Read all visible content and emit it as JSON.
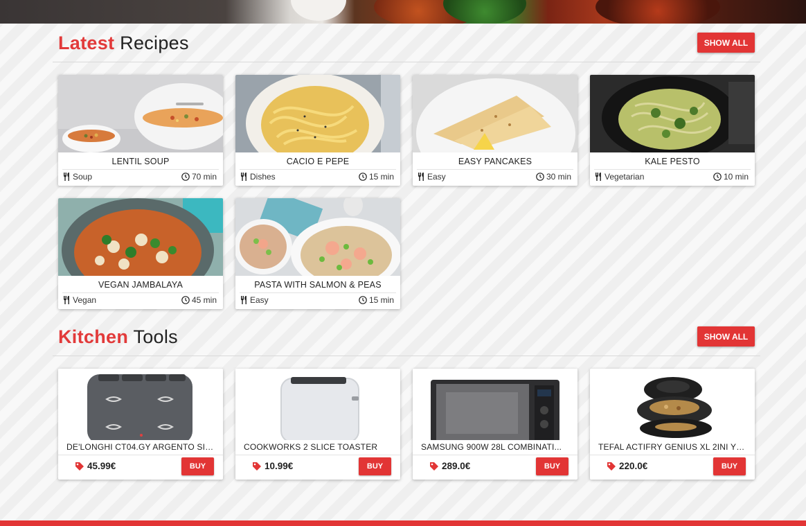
{
  "latest": {
    "title_accent": "Latest",
    "title_rest": "Recipes",
    "show_all": "SHOW ALL",
    "recipes": [
      {
        "name": "LENTIL SOUP",
        "category": "Soup",
        "time": "70 min"
      },
      {
        "name": "CACIO E PEPE",
        "category": "Dishes",
        "time": "15 min"
      },
      {
        "name": "EASY PANCAKES",
        "category": "Easy",
        "time": "30 min"
      },
      {
        "name": "KALE PESTO",
        "category": "Vegetarian",
        "time": "10 min"
      },
      {
        "name": "VEGAN JAMBALAYA",
        "category": "Vegan",
        "time": "45 min"
      },
      {
        "name": "PASTA WITH SALMON & PEAS",
        "category": "Easy",
        "time": "15 min"
      }
    ]
  },
  "tools": {
    "title_accent": "Kitchen",
    "title_rest": "Tools",
    "show_all": "SHOW ALL",
    "buy_label": "BUY",
    "items": [
      {
        "name": "DE'LONGHI CT04.GY ARGENTO SIL...",
        "price": "45.99€"
      },
      {
        "name": "COOKWORKS 2 SLICE TOASTER",
        "price": "10.99€"
      },
      {
        "name": "SAMSUNG 900W 28L COMBINATI...",
        "price": "289.0€"
      },
      {
        "name": "TEFAL ACTIFRY GENIUS XL 2INI YV...",
        "price": "220.0€"
      }
    ]
  },
  "colors": {
    "accent": "#e23535"
  },
  "icons": {
    "category": "utensils-icon",
    "time": "clock-icon",
    "price": "tag-icon"
  }
}
